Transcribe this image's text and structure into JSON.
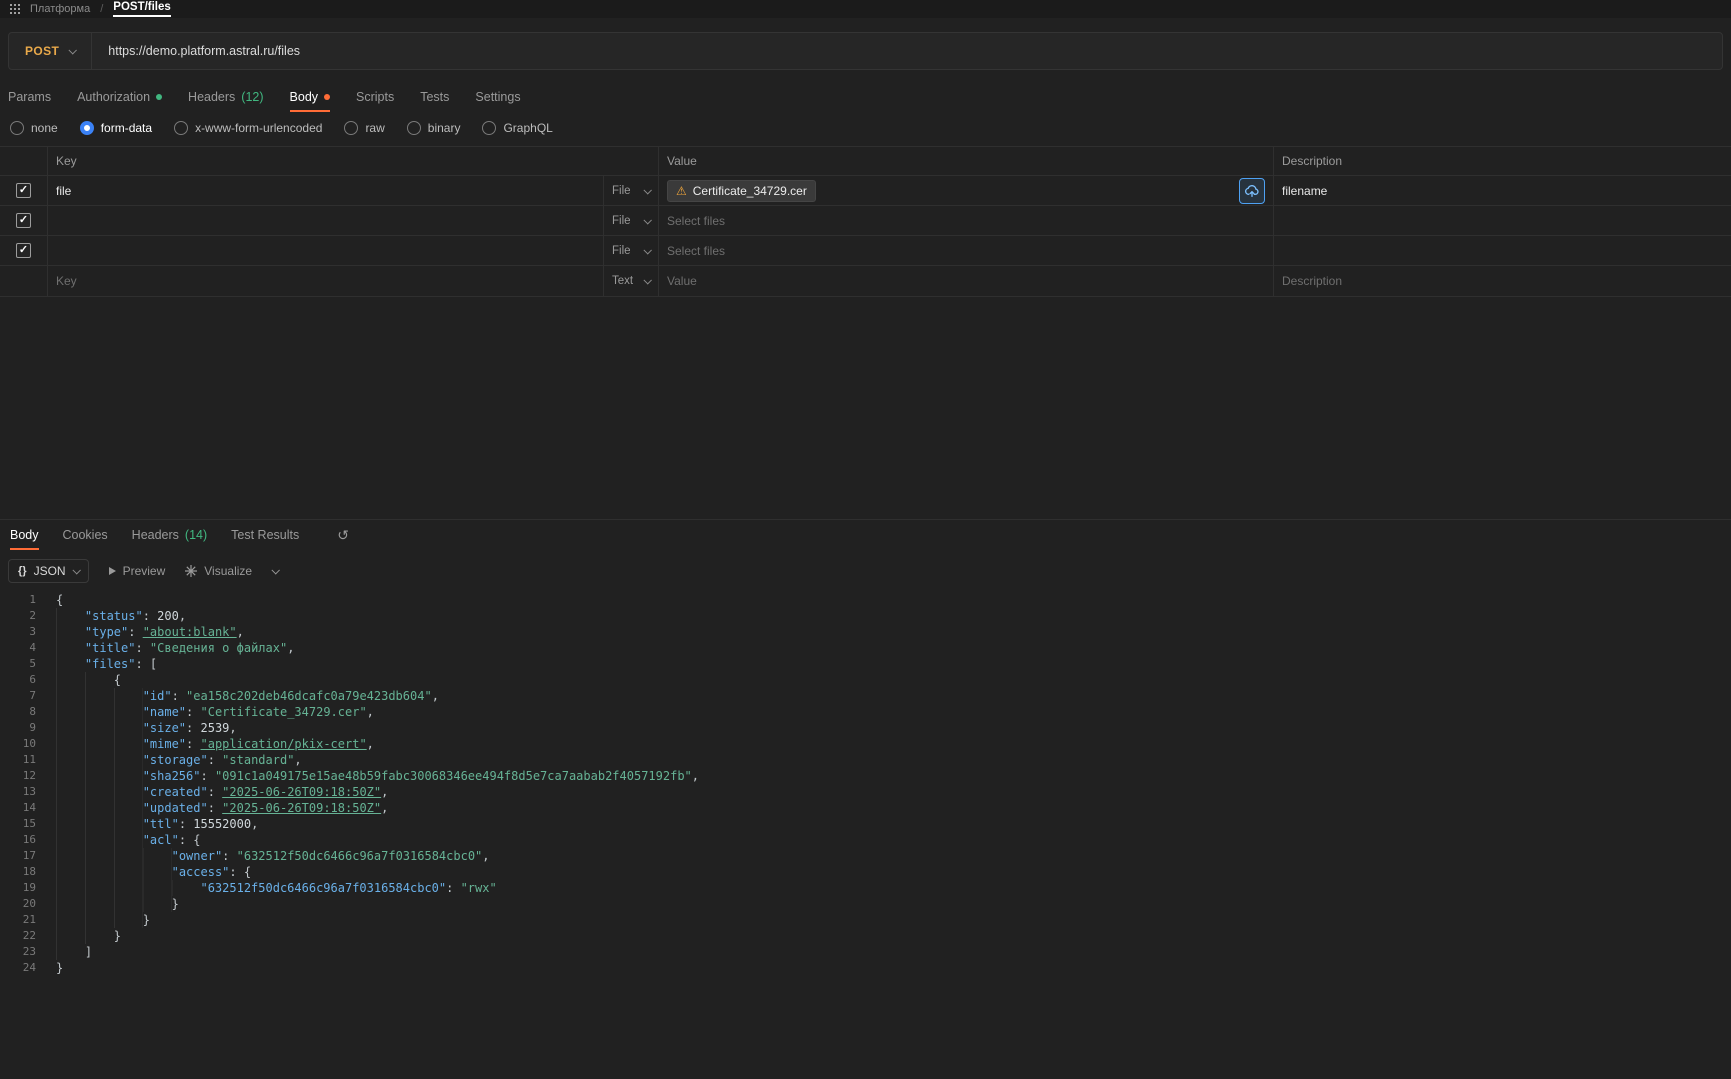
{
  "topbar": {
    "app": "Платформа",
    "separator": "/",
    "page": "POST/files"
  },
  "request": {
    "method": "POST",
    "url": "https://demo.platform.astral.ru/files"
  },
  "request_tabs": [
    {
      "label": "Params"
    },
    {
      "label": "Authorization",
      "dot": "green"
    },
    {
      "label": "Headers",
      "count": "(12)"
    },
    {
      "label": "Body",
      "dot": "orange",
      "active": true
    },
    {
      "label": "Scripts"
    },
    {
      "label": "Tests"
    },
    {
      "label": "Settings"
    }
  ],
  "body_modes": {
    "options": [
      {
        "label": "none"
      },
      {
        "label": "form-data",
        "selected": true
      },
      {
        "label": "x-www-form-urlencoded"
      },
      {
        "label": "raw"
      },
      {
        "label": "binary"
      },
      {
        "label": "GraphQL"
      }
    ]
  },
  "form_table": {
    "headers": {
      "key": "Key",
      "value": "Value",
      "description": "Description"
    },
    "rows": [
      {
        "checked": true,
        "key": "file",
        "type": "File",
        "file_name": "Certificate_34729.cer",
        "description": "filename"
      },
      {
        "checked": true,
        "type": "File",
        "value_placeholder": "Select files"
      },
      {
        "checked": true,
        "type": "File",
        "value_placeholder": "Select files"
      }
    ],
    "new_row": {
      "key_placeholder": "Key",
      "type": "Text",
      "value_placeholder": "Value",
      "description_placeholder": "Description"
    }
  },
  "response": {
    "tabs": [
      {
        "label": "Body",
        "active": true
      },
      {
        "label": "Cookies"
      },
      {
        "label": "Headers",
        "count": "(14)"
      },
      {
        "label": "Test Results"
      }
    ],
    "toolbar": {
      "format_icon": "{}",
      "format": "JSON",
      "preview": "Preview",
      "visualize": "Visualize"
    },
    "link_values": [
      "about:blank",
      "application/pkix-cert",
      "2025-06-26T09:18:50Z"
    ],
    "code_lines": [
      "{",
      "    \"status\": 200,",
      "    \"type\": \"about:blank\",",
      "    \"title\": \"Сведения о файлах\",",
      "    \"files\": [",
      "        {",
      "            \"id\": \"ea158c202deb46dcafc0a79e423db604\",",
      "            \"name\": \"Certificate_34729.cer\",",
      "            \"size\": 2539,",
      "            \"mime\": \"application/pkix-cert\",",
      "            \"storage\": \"standard\",",
      "            \"sha256\": \"091c1a049175e15ae48b59fabc30068346ee494f8d5e7ca7aabab2f4057192fb\",",
      "            \"created\": \"2025-06-26T09:18:50Z\",",
      "            \"updated\": \"2025-06-26T09:18:50Z\",",
      "            \"ttl\": 15552000,",
      "            \"acl\": {",
      "                \"owner\": \"632512f50dc6466c96a7f0316584cbc0\",",
      "                \"access\": {",
      "                    \"632512f50dc6466c96a7f0316584cbc0\": \"rwx\"",
      "                }",
      "            }",
      "        }",
      "    ]",
      "}"
    ]
  },
  "colors": {
    "accent_orange": "#ff6c37",
    "method_post": "#e9a94a",
    "success_green": "#41b780",
    "link_blue": "#4ea1f3",
    "json_key_blue": "#6ab0e8",
    "json_string_teal": "#66b395",
    "warning_orange": "#f2a73b"
  }
}
